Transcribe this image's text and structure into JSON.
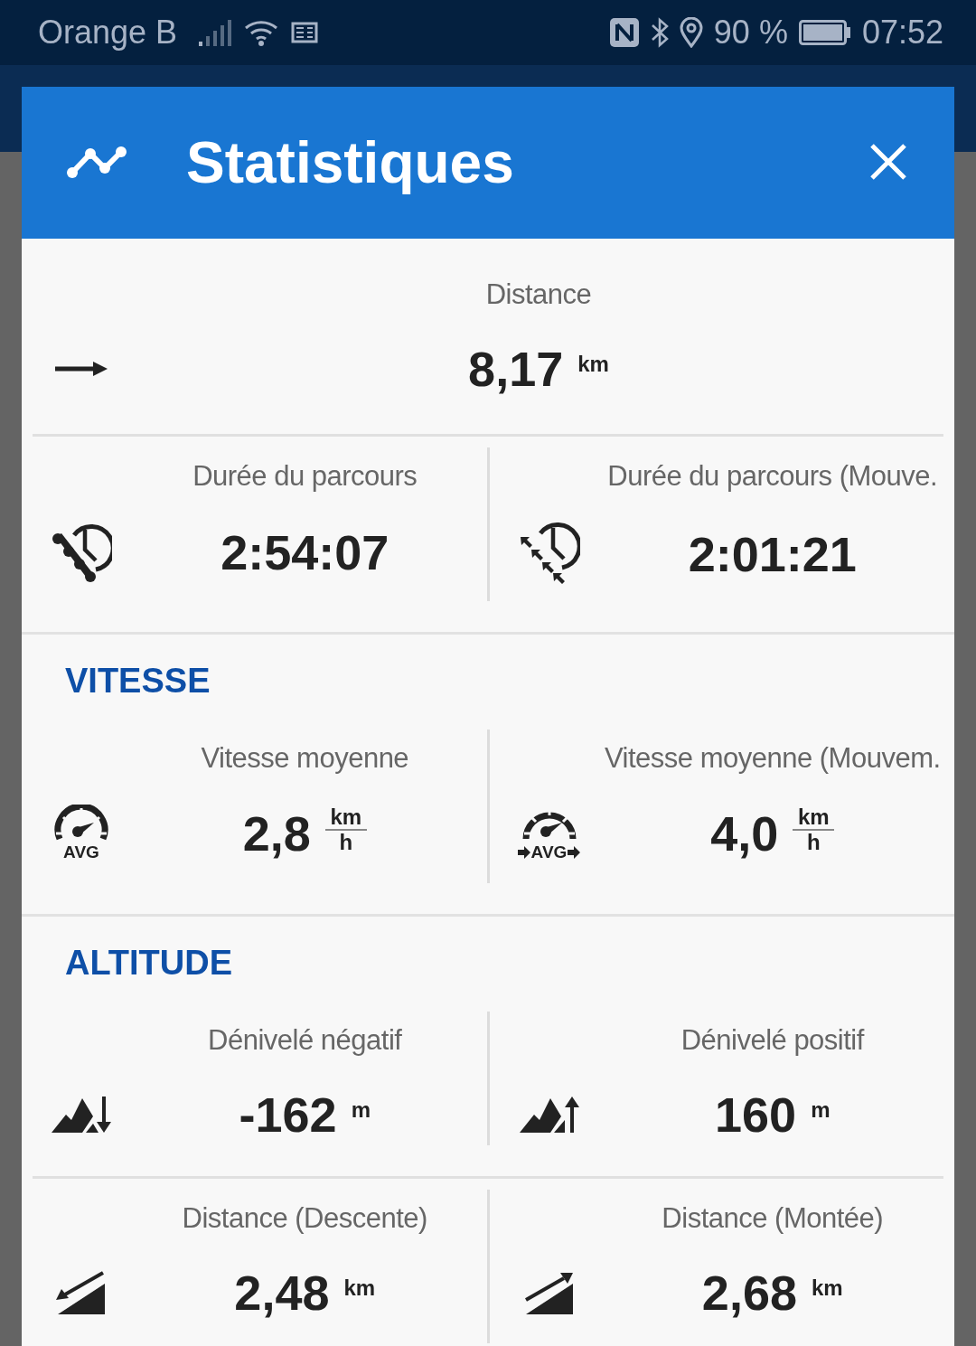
{
  "status_bar": {
    "carrier": "Orange B",
    "battery": "90 %",
    "time": "07:52"
  },
  "dialog": {
    "title": "Statistiques"
  },
  "sections": [
    {
      "rows": [
        [
          {
            "kind": "arrow",
            "label": "Distance",
            "value": "8,17",
            "unit": {
              "kind": "plain",
              "text": "km"
            }
          }
        ],
        [
          {
            "kind": "clock-dots",
            "label": "Durée du parcours",
            "value": "2:54:07"
          },
          {
            "kind": "clock-arrows",
            "label": "Durée du parcours (Mouve.",
            "value": "2:01:21"
          }
        ]
      ]
    },
    {
      "heading": "VITESSE",
      "rows": [
        [
          {
            "kind": "gauge",
            "icon_text": "AVG",
            "label": "Vitesse moyenne",
            "value": "2,8",
            "unit": {
              "kind": "fraction",
              "top": "km",
              "bottom": "h"
            }
          },
          {
            "kind": "gauge-arrows",
            "icon_text": "AVG",
            "label": "Vitesse moyenne (Mouvem.",
            "value": "4,0",
            "unit": {
              "kind": "fraction",
              "top": "km",
              "bottom": "h"
            }
          }
        ]
      ]
    },
    {
      "heading": "ALTITUDE",
      "rows": [
        [
          {
            "kind": "mountain-down",
            "label": "Dénivelé négatif",
            "value": "-162",
            "unit": {
              "kind": "plain",
              "text": "m"
            }
          },
          {
            "kind": "mountain-up",
            "label": "Dénivelé positif",
            "value": "160",
            "unit": {
              "kind": "plain",
              "text": "m"
            }
          }
        ],
        [
          {
            "kind": "slope-down",
            "label": "Distance (Descente)",
            "value": "2,48",
            "unit": {
              "kind": "plain",
              "text": "km"
            }
          },
          {
            "kind": "slope-up",
            "label": "Distance (Montée)",
            "value": "2,68",
            "unit": {
              "kind": "plain",
              "text": "km"
            }
          }
        ]
      ]
    }
  ]
}
